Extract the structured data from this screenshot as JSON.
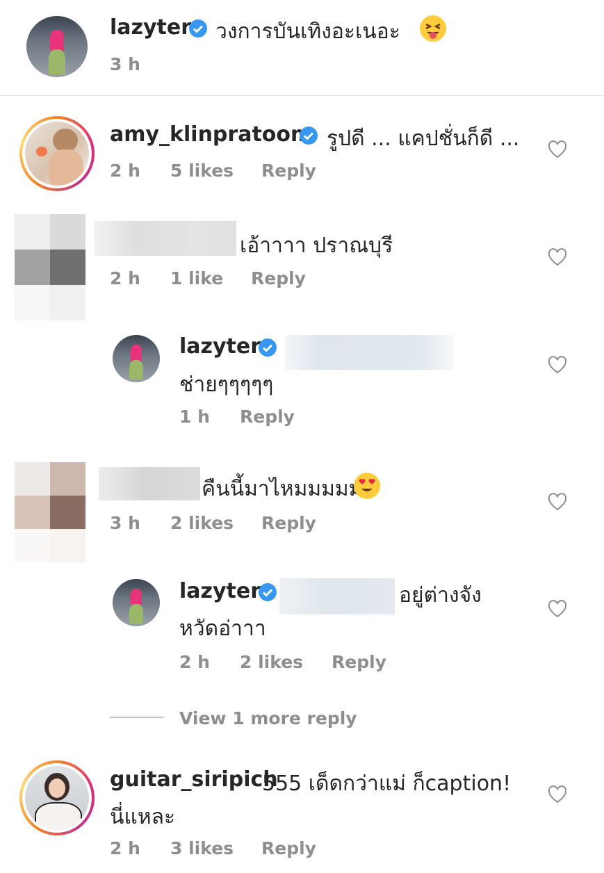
{
  "comments": [
    {
      "username": "lazyter",
      "text": "วงการบันเทิงอะเนอะ",
      "emoji": "squinting-tongue-face-emoji",
      "time": "3 h"
    },
    {
      "username": "amy_klinpratoom",
      "text": "รูปดี ... แคปชั่นก็ดี ...",
      "time": "2 h",
      "likes": "5 likes",
      "reply": "Reply"
    },
    {
      "username": "",
      "text": "เอ้าาาา ปราณบุรี",
      "time": "2 h",
      "likes": "1 like",
      "reply": "Reply"
    },
    {
      "username": "lazyter",
      "text": "ช่ายๆๆๆๆๆ",
      "time": "1 h",
      "reply": "Reply"
    },
    {
      "username": "",
      "text": "คืนนี้มาไหมมมมม",
      "emoji": "heart-eyes-emoji",
      "time": "3 h",
      "likes": "2 likes",
      "reply": "Reply"
    },
    {
      "username": "lazyter",
      "text_line1": "อยู่ต่างจัง",
      "text_line2": "หวัดอ่าาา",
      "time": "2 h",
      "likes": "2 likes",
      "reply": "Reply"
    },
    {
      "username": "guitar_siripich",
      "text_line1": "555 เด็ดกว่าแม่ ก็caption!",
      "text_line2": "นี่แหละ",
      "time": "2 h",
      "likes": "3 likes",
      "reply": "Reply"
    }
  ],
  "view_more": "View 1 more reply",
  "colors": {
    "verified": "#3897f0",
    "meta": "#8e8e8e",
    "text": "#262626"
  }
}
